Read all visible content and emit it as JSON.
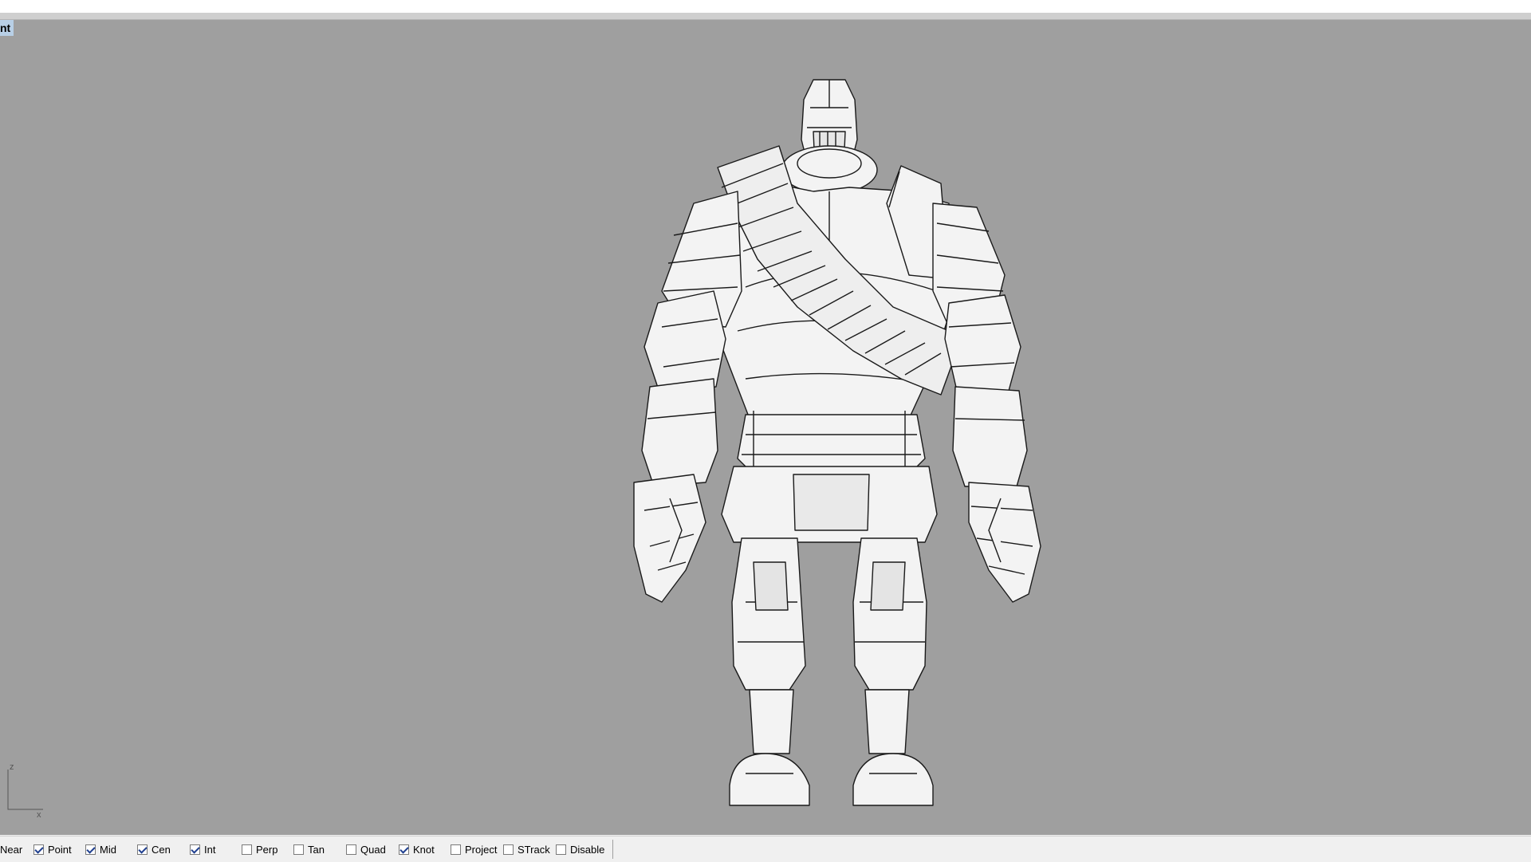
{
  "viewport": {
    "label": "nt",
    "background": "#9f9f9f",
    "axis": {
      "z_label": "z",
      "x_label": "x"
    }
  },
  "osnap": {
    "items": [
      {
        "label": "Near",
        "checked": null
      },
      {
        "label": "Point",
        "checked": true
      },
      {
        "label": "Mid",
        "checked": true
      },
      {
        "label": "Cen",
        "checked": true
      },
      {
        "label": "Int",
        "checked": true
      },
      {
        "label": "Perp",
        "checked": false
      },
      {
        "label": "Tan",
        "checked": false
      },
      {
        "label": "Quad",
        "checked": false
      },
      {
        "label": "Knot",
        "checked": true
      },
      {
        "label": "Project",
        "checked": false
      },
      {
        "label": "STrack",
        "checked": false
      },
      {
        "label": "Disable",
        "checked": false
      }
    ]
  }
}
